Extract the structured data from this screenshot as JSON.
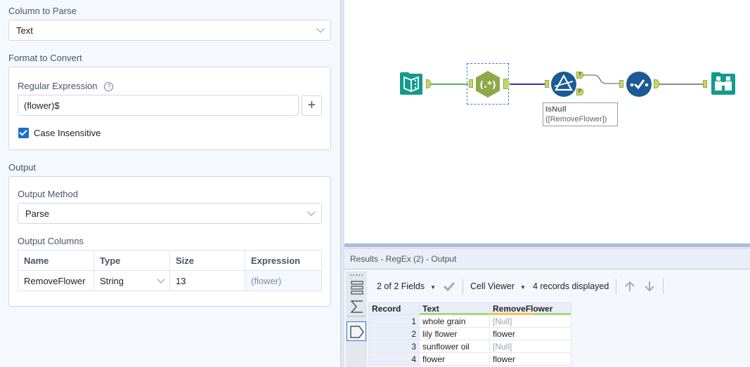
{
  "config": {
    "column_to_parse": {
      "label": "Column to Parse",
      "value": "Text"
    },
    "format_to_convert": {
      "label": "Format to Convert",
      "regex_label": "Regular Expression",
      "help_icon": "question-circle-icon",
      "regex_value": "(flower)$",
      "add_button": "+",
      "case_insensitive_label": "Case Insensitive",
      "case_insensitive_checked": true
    },
    "output": {
      "label": "Output",
      "method_label": "Output Method",
      "method_value": "Parse",
      "columns_label": "Output Columns",
      "columns_headers": [
        "Name",
        "Type",
        "Size",
        "Expression"
      ],
      "columns_rows": [
        {
          "name": "RemoveFlower",
          "type": "String",
          "size": "13",
          "expression": "(flower)"
        }
      ]
    }
  },
  "canvas": {
    "tools": [
      {
        "name": "Input Data",
        "icon": "book-icon",
        "color": "#129b8e"
      },
      {
        "name": "RegEx",
        "icon": "regex-icon",
        "label": "(.*)",
        "color": "#8fa84a"
      },
      {
        "name": "Filter",
        "icon": "filter-icon",
        "color": "#1b5a94",
        "anchors": [
          "T",
          "F"
        ]
      },
      {
        "name": "Select",
        "icon": "select-check-icon",
        "color": "#1b5a94"
      },
      {
        "name": "Browse",
        "icon": "binoculars-icon",
        "color": "#129b8e"
      }
    ],
    "filter_annotation_line1": "IsNull",
    "filter_annotation_line2": "([RemoveFlower])",
    "colors": {
      "wire_green": "#5aad6b",
      "wire_blue": "#2f2fb4",
      "wire_gray": "#8a8a8a"
    }
  },
  "results": {
    "title": "Results - RegEx (2) - Output",
    "fields_label": "2 of 2 Fields",
    "viewer_label": "Cell Viewer",
    "records_label": "4 records displayed",
    "headers": [
      "Record",
      "Text",
      "RemoveFlower"
    ],
    "rows": [
      {
        "record": "1",
        "text": "whole grain",
        "remove": "[Null]",
        "is_null": true
      },
      {
        "record": "2",
        "text": "lily flower",
        "remove": "flower",
        "is_null": false
      },
      {
        "record": "3",
        "text": "sunflower oil",
        "remove": "[Null]",
        "is_null": true
      },
      {
        "record": "4",
        "text": "flower",
        "remove": "flower",
        "is_null": false
      }
    ]
  }
}
